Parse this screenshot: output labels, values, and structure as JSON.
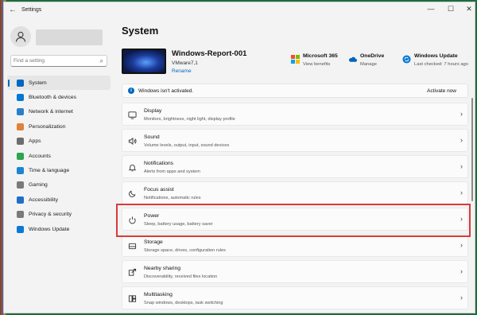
{
  "window": {
    "title": "Settings",
    "back_glyph": "←",
    "minimize_glyph": "—",
    "maximize_glyph": "☐",
    "close_glyph": "✕"
  },
  "sidebar": {
    "search_placeholder": "Find a setting",
    "search_icon": "search-icon",
    "items": [
      {
        "label": "System",
        "icon": "system-icon",
        "color": "#0067c0",
        "active": true
      },
      {
        "label": "Bluetooth & devices",
        "icon": "bluetooth-icon",
        "color": "#0078d4",
        "active": false
      },
      {
        "label": "Network & internet",
        "icon": "network-icon",
        "color": "#2a80c8",
        "active": false
      },
      {
        "label": "Personalization",
        "icon": "personalization-icon",
        "color": "#e0823a",
        "active": false
      },
      {
        "label": "Apps",
        "icon": "apps-icon",
        "color": "#6d6d6d",
        "active": false
      },
      {
        "label": "Accounts",
        "icon": "accounts-icon",
        "color": "#2ea44f",
        "active": false
      },
      {
        "label": "Time & language",
        "icon": "time-language-icon",
        "color": "#1a86d0",
        "active": false
      },
      {
        "label": "Gaming",
        "icon": "gaming-icon",
        "color": "#7a7a7a",
        "active": false
      },
      {
        "label": "Accessibility",
        "icon": "accessibility-icon",
        "color": "#1f6fc5",
        "active": false
      },
      {
        "label": "Privacy & security",
        "icon": "shield-icon",
        "color": "#7a7a7a",
        "active": false
      },
      {
        "label": "Windows Update",
        "icon": "windows-update-icon",
        "color": "#0a7ad6",
        "active": false
      }
    ]
  },
  "main": {
    "heading": "System",
    "device": {
      "name": "Windows-Report-001",
      "model": "VMware7,1",
      "rename": "Rename"
    },
    "services": [
      {
        "title": "Microsoft 365",
        "subtitle": "View benefits",
        "icon": "microsoft-365-icon"
      },
      {
        "title": "OneDrive",
        "subtitle": "Manage",
        "icon": "onedrive-icon"
      },
      {
        "title": "Windows Update",
        "subtitle": "Last checked: 7 hours ago",
        "icon": "windows-update-icon"
      }
    ],
    "activation_banner": {
      "text": "Windows isn't activated.",
      "action": "Activate now"
    },
    "settings": [
      {
        "title": "Display",
        "subtitle": "Monitors, brightness, night light, display profile",
        "icon": "display-icon"
      },
      {
        "title": "Sound",
        "subtitle": "Volume levels, output, input, sound devices",
        "icon": "sound-icon"
      },
      {
        "title": "Notifications",
        "subtitle": "Alerts from apps and system",
        "icon": "notifications-icon"
      },
      {
        "title": "Focus assist",
        "subtitle": "Notifications, automatic rules",
        "icon": "focus-assist-icon"
      },
      {
        "title": "Power",
        "subtitle": "Sleep, battery usage, battery saver",
        "icon": "power-icon",
        "highlighted": true
      },
      {
        "title": "Storage",
        "subtitle": "Storage space, drives, configuration rules",
        "icon": "storage-icon"
      },
      {
        "title": "Nearby sharing",
        "subtitle": "Discoverability, received files location",
        "icon": "nearby-sharing-icon"
      },
      {
        "title": "Multitasking",
        "subtitle": "Snap windows, desktops, task switching",
        "icon": "multitasking-icon"
      }
    ],
    "chevron": "›"
  },
  "colors": {
    "accent": "#0067c0",
    "highlight": "#d93a3a"
  }
}
